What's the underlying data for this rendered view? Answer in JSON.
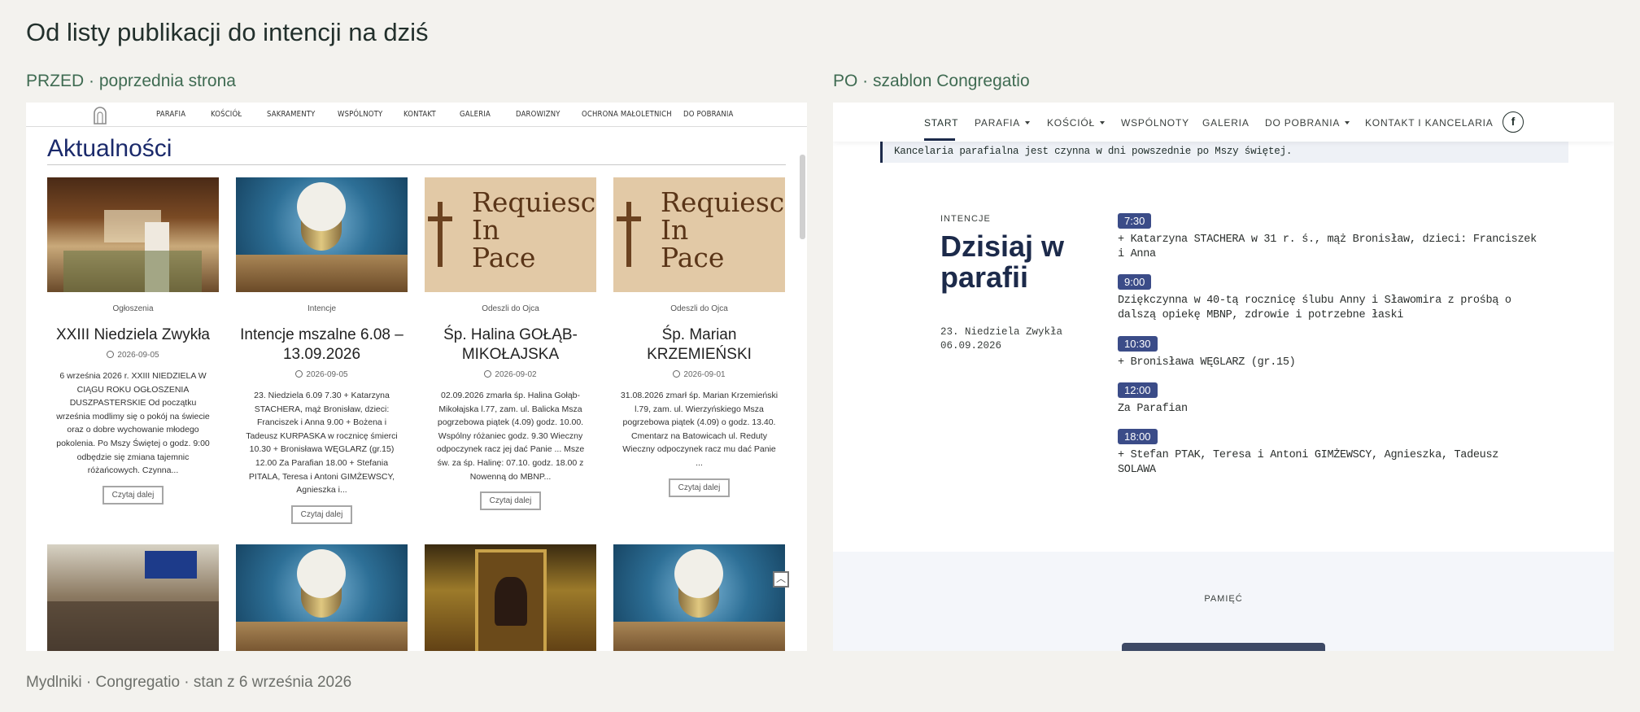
{
  "page": {
    "title": "Od listy publikacji do intencji na dziś",
    "footer": "Mydlniki · Congregatio · stan z 6 września 2026"
  },
  "before": {
    "label": "PRZED · poprzednia strona",
    "nav": [
      "PARAFIA",
      "KOŚCIÓŁ",
      "SAKRAMENTY",
      "WSPÓLNOTY",
      "KONTAKT",
      "GALERIA",
      "DAROWIZNY",
      "OCHRONA MAŁOLETNICH",
      "DO POBRANIA"
    ],
    "heading": "Aktualności",
    "read_more": "Czytaj dalej",
    "up_icon": "chevron-up-icon",
    "cards": [
      {
        "image": "altar-photo",
        "category": "Ogłoszenia",
        "title": "XXIII Niedziela Zwykła",
        "date": "2026-09-05",
        "excerpt": "6 września 2026 r. XXIII NIEDZIELA W CIĄGU ROKU OGŁOSZENIA DUSZPASTERSKIE     Od początku września modlimy się o pokój na świecie oraz o dobre wychowanie młodego pokolenia. Po Mszy Świętej o godz. 9:00 odbędzie się zmiana tajemnic różańcowych. Czynna..."
      },
      {
        "image": "chalice-photo",
        "category": "Intencje",
        "title": "Intencje mszalne 6.08 – 13.09.2026",
        "date": "2026-09-05",
        "excerpt": "23. Niedziela 6.09 7.30 + Katarzyna STACHERA, mąż Bronisław, dzieci: Franciszek i Anna 9.00 + Bożena i Tadeusz KURPASKA w rocznicę śmierci 10.30 + Bronisława WĘGLARZ (gr.15) 12.00 Za Parafian 18.00 + Stefania PITALA, Teresa i Antoni GIMŻEWSCY, Agnieszka i..."
      },
      {
        "image": "requiescat-graphic",
        "image_text": [
          "Requiescat",
          "In",
          "Pace"
        ],
        "category": "Odeszli do Ojca",
        "title": "Śp. Halina GOŁĄB-MIKOŁAJSKA",
        "date": "2026-09-02",
        "excerpt": "02.09.2026 zmarła śp. Halina Gołąb-Mikołajska l.77, zam. ul. Balicka Msza pogrzebowa piątek (4.09) godz. 10.00. Wspólny różaniec godz. 9.30     Wieczny odpoczynek racz jej dać Panie ... Msze św. za śp. Halinę: 07.10. godz. 18.00 z Nowenną do MBNP..."
      },
      {
        "image": "requiescat-graphic",
        "image_text": [
          "Requiescat",
          "In",
          "Pace"
        ],
        "category": "Odeszli do Ojca",
        "title": "Śp. Marian KRZEMIEŃSKI",
        "date": "2026-09-01",
        "excerpt": "31.08.2026 zmarł śp. Marian Krzemieński l.79, zam. ul. Wierzyńskiego Msza pogrzebowa piątek (4.09) o godz. 13.40. Cmentarz na Batowicach ul. Reduty Wieczny odpoczynek racz mu dać Panie ..."
      }
    ],
    "second_row": [
      "congregation-photo",
      "chalice-photo",
      "icon-painting",
      "chalice-photo"
    ]
  },
  "after": {
    "label": "PO · szablon Congregatio",
    "nav": [
      {
        "label": "START",
        "dropdown": false,
        "active": true
      },
      {
        "label": "PARAFIA",
        "dropdown": true
      },
      {
        "label": "KOŚCIÓŁ",
        "dropdown": true
      },
      {
        "label": "WSPÓLNOTY",
        "dropdown": false
      },
      {
        "label": "GALERIA",
        "dropdown": false
      },
      {
        "label": "DO POBRANIA",
        "dropdown": true
      },
      {
        "label": "KONTAKT I KANCELARIA",
        "dropdown": false
      }
    ],
    "facebook_icon": "facebook-icon",
    "facebook_glyph": "f",
    "notice": "Kancelaria parafialna jest czynna w dni powszednie po Mszy świętej.",
    "intentions": {
      "label": "INTENCJE",
      "title": "Dzisiaj w parafii",
      "day_name": "23. Niedziela Zwykła",
      "date": "06.09.2026",
      "masses": [
        {
          "time": "7:30",
          "intention": "+ Katarzyna STACHERA w 31 r. ś., mąż Bronisław, dzieci: Franciszek i Anna"
        },
        {
          "time": "9:00",
          "intention": "Dziękczynna w 40-tą rocznicę ślubu Anny i Sławomira z prośbą o dalszą opiekę MBNP, zdrowie i potrzebne łaski"
        },
        {
          "time": "10:30",
          "intention": "+ Bronisława WĘGLARZ (gr.15)"
        },
        {
          "time": "12:00",
          "intention": "Za Parafian"
        },
        {
          "time": "18:00",
          "intention": "+ Stefan PTAK, Teresa i Antoni GIMŻEWSCY, Agnieszka, Tadeusz SOLAWA"
        }
      ]
    },
    "memory_label": "PAMIĘĆ"
  },
  "colors": {
    "background": "#f3f2ee",
    "old_heading": "#1b2a6b",
    "new_navy": "#1c2a4a",
    "time_badge": "#3b4c88",
    "label_green": "#3f6b52"
  }
}
